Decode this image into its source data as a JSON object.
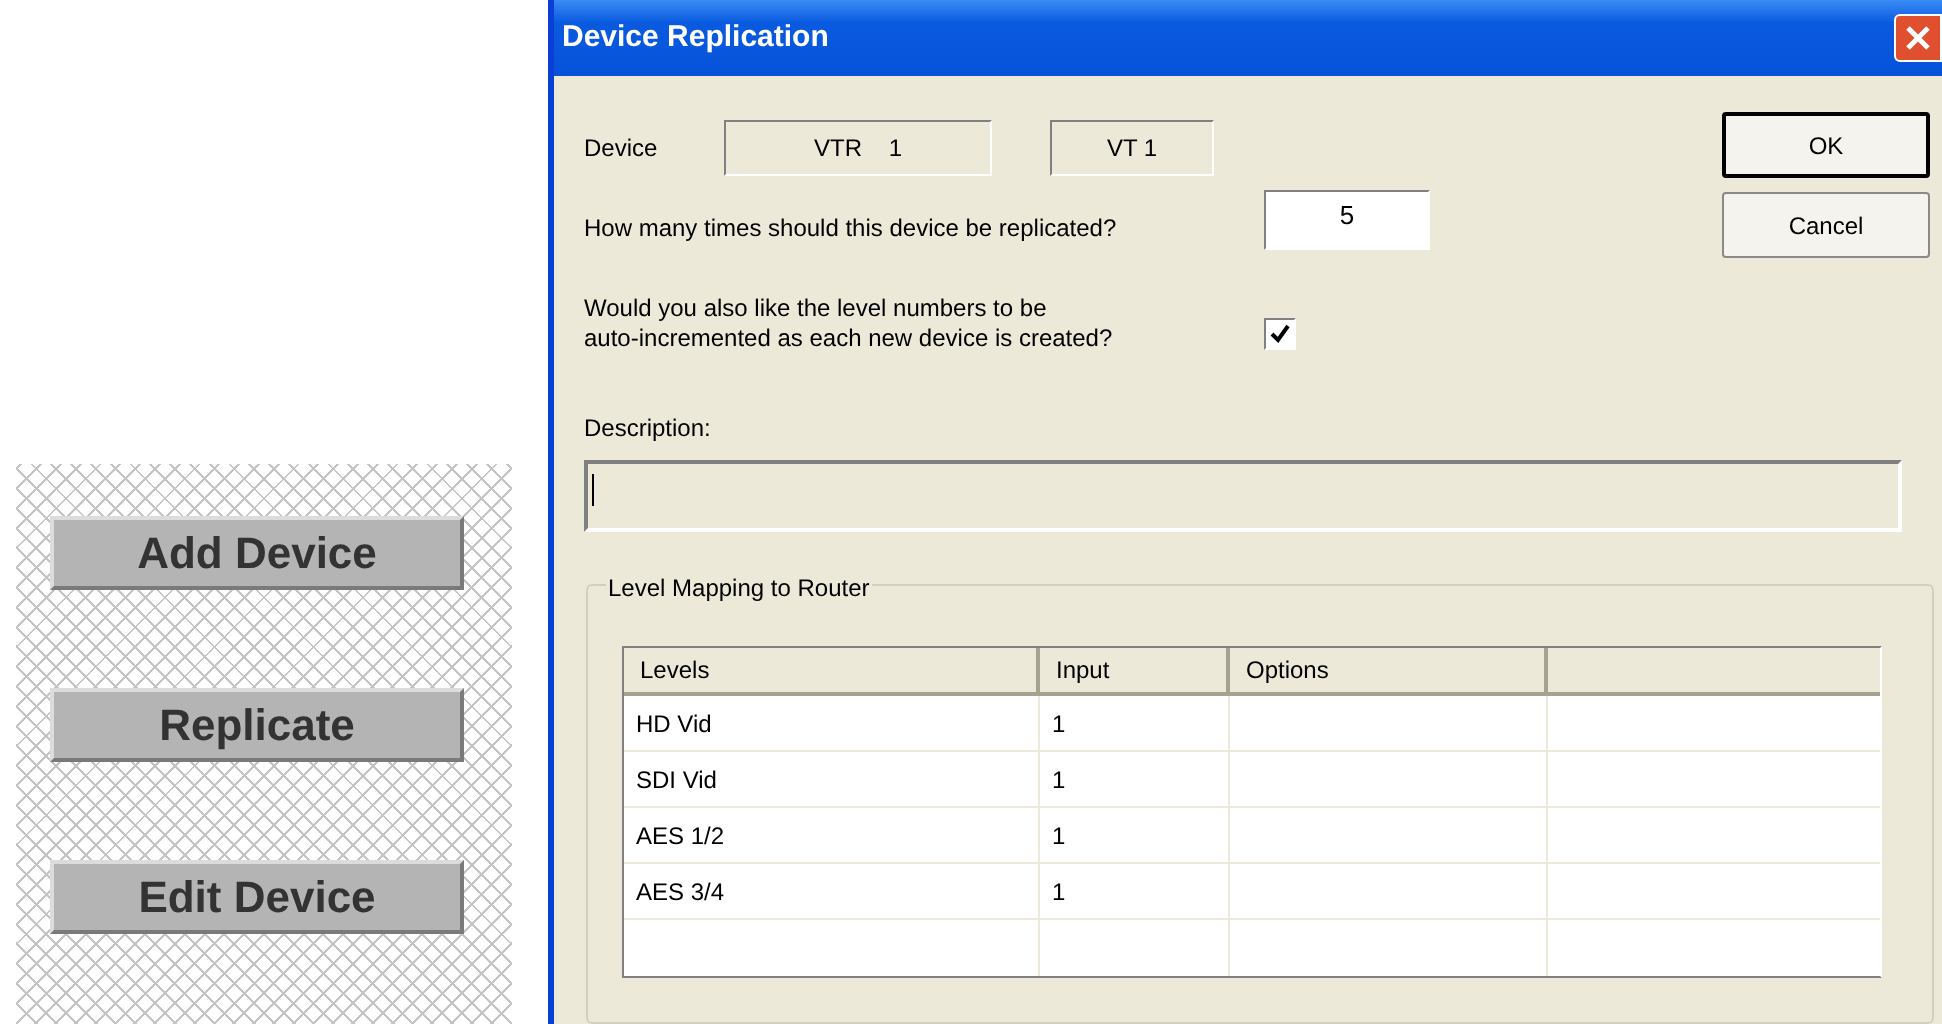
{
  "side_buttons": [
    "Add Device",
    "Replicate",
    "Edit Device"
  ],
  "dialog": {
    "title": "Device Replication",
    "device_label": "Device",
    "device_name": "VTR    1",
    "device_short": "VT 1",
    "buttons": [
      {
        "label": "OK",
        "default": true
      },
      {
        "label": "Cancel",
        "default": false
      }
    ],
    "replicate_question": "How many times should this device be replicated?",
    "replicate_count": "5",
    "auto_increment": {
      "label": "Would you also like the level numbers to be\nauto-incremented as each new device is created?",
      "checked": true
    },
    "description_label": "Description:",
    "group_title": "Level Mapping to Router",
    "table": {
      "columns": [
        "Levels",
        "Input",
        "Options"
      ],
      "rows": [
        {
          "levels": "HD Vid",
          "input": "1"
        },
        {
          "levels": "SDI Vid",
          "input": "1"
        },
        {
          "levels": "AES 1/2",
          "input": "1"
        },
        {
          "levels": "AES 3/4",
          "input": "1"
        }
      ]
    }
  }
}
